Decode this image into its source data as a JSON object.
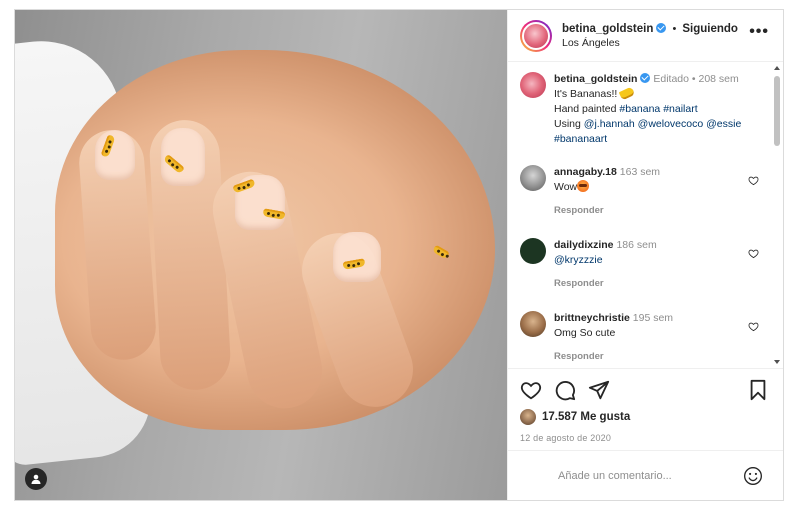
{
  "post": {
    "author": {
      "username": "betina_goldstein",
      "location": "Los Ángeles",
      "follow_status": "Siguiendo",
      "verified": true
    },
    "caption": {
      "username": "betina_goldstein",
      "edited": "Editado",
      "age": "208 sem",
      "line1": "It's Bananas!!",
      "line2_prefix": "Hand painted",
      "line2_tags": [
        "#banana",
        "#nailart"
      ],
      "line3_prefix": "Using",
      "line3_mentions": [
        "@j.hannah",
        "@welovecoco",
        "@essie"
      ],
      "line4_tag": "#bananaart"
    },
    "comments": [
      {
        "username": "annagaby.18",
        "age": "163 sem",
        "text": "Wow",
        "reply_label": "Responder"
      },
      {
        "username": "dailydixzine",
        "age": "186 sem",
        "text": "@kryzzzie",
        "reply_label": "Responder"
      },
      {
        "username": "brittneychristie",
        "age": "195 sem",
        "text": "Omg So cute",
        "reply_label": "Responder"
      }
    ],
    "likes": "17.587 Me gusta",
    "date": "12 de agosto de 2020",
    "add_comment_placeholder": "Añade un comentario...",
    "icons": [
      "heart-icon",
      "comment-icon",
      "share-icon",
      "bookmark-icon",
      "more-icon",
      "emoji-icon",
      "user-tag-icon"
    ],
    "colors": {
      "link": "#00376b",
      "muted": "#8e8e8e",
      "verified": "#3897f0"
    }
  }
}
